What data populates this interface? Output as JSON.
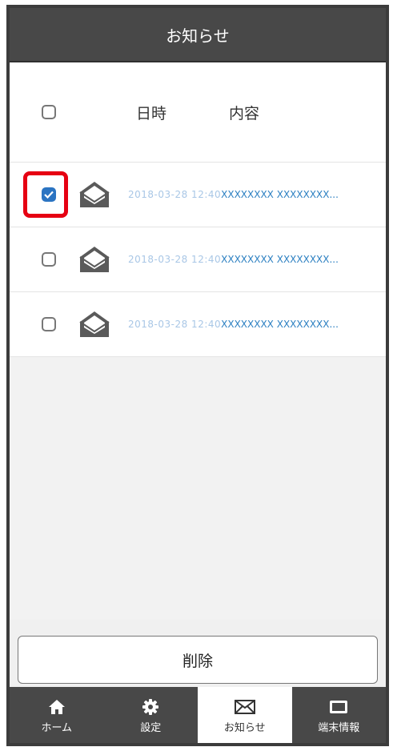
{
  "header": {
    "title": "お知らせ"
  },
  "table": {
    "col_date": "日時",
    "col_content": "内容",
    "rows": [
      {
        "checked": true,
        "date": "2018-03-28 12:40",
        "content": "XXXXXXXX XXXXXXXX..."
      },
      {
        "checked": false,
        "date": "2018-03-28 12:40",
        "content": "XXXXXXXX XXXXXXXX..."
      },
      {
        "checked": false,
        "date": "2018-03-28 12:40",
        "content": "XXXXXXXX XXXXXXXX..."
      }
    ]
  },
  "actions": {
    "delete_label": "削除"
  },
  "nav": {
    "items": [
      {
        "label": "ホーム",
        "icon": "home-icon"
      },
      {
        "label": "設定",
        "icon": "gear-icon"
      },
      {
        "label": "お知らせ",
        "icon": "envelope-icon"
      },
      {
        "label": "端末情報",
        "icon": "device-icon"
      }
    ],
    "active_index": 2
  },
  "colors": {
    "accent": "#2b74c2",
    "highlight": "#e60012",
    "header_bg": "#484848"
  }
}
